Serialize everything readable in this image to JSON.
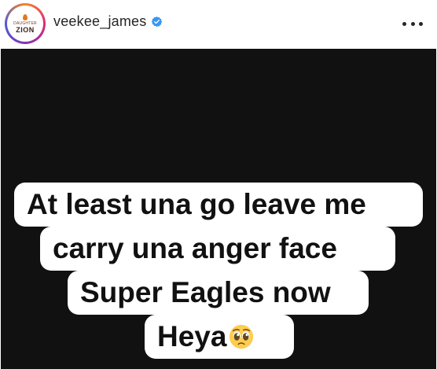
{
  "header": {
    "username": "veekee_james",
    "avatar_logo": {
      "top_text": "DAUGHTER",
      "bottom_text": "ZION"
    },
    "verified_icon": "verified-badge-icon",
    "more_icon": "more-options-icon"
  },
  "story": {
    "lines": [
      "At least una go leave me",
      "carry una anger face",
      "Super Eagles now",
      "Heya"
    ],
    "emoji": "pleading-face-emoji"
  },
  "colors": {
    "story_background": "#111111",
    "caption_background": "#ffffff",
    "caption_text": "#111111",
    "verified_badge": "#3897f0"
  }
}
